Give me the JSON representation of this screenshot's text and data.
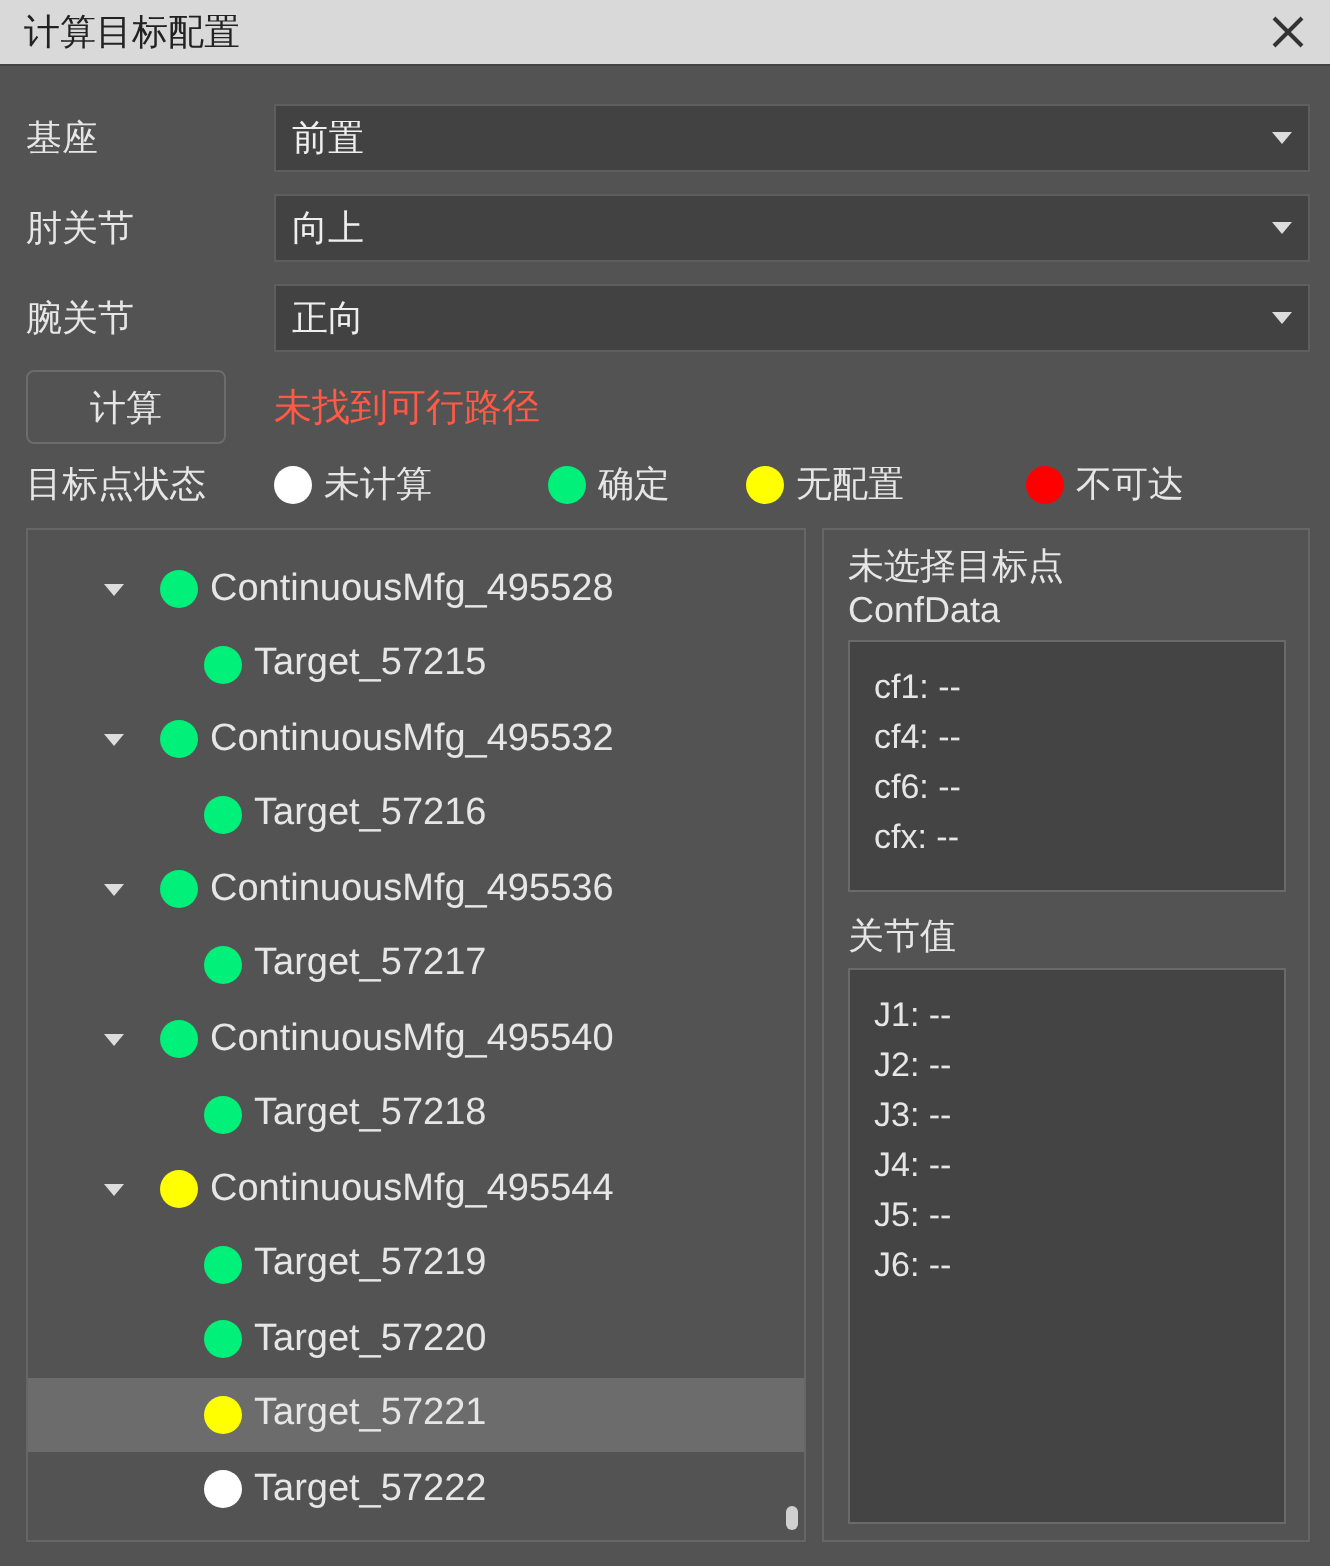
{
  "window": {
    "title": "计算目标配置"
  },
  "settings": [
    {
      "label": "基座",
      "value": "前置"
    },
    {
      "label": "肘关节",
      "value": "向上"
    },
    {
      "label": "腕关节",
      "value": "正向"
    }
  ],
  "calculate_button": "计算",
  "message": "未找到可行路径",
  "legend": {
    "label": "目标点状态",
    "items": [
      {
        "label": "未计算",
        "color": "#ffffff"
      },
      {
        "label": "确定",
        "color": "#00f07a"
      },
      {
        "label": "无配置",
        "color": "#ffff00"
      },
      {
        "label": "不可达",
        "color": "#ff0000"
      }
    ]
  },
  "tree": [
    {
      "label": "ContinuousMfg_495528",
      "color": "#00f07a",
      "expanded": true,
      "selected": false,
      "children": [
        {
          "label": "Target_57215",
          "color": "#00f07a",
          "selected": false
        }
      ]
    },
    {
      "label": "ContinuousMfg_495532",
      "color": "#00f07a",
      "expanded": true,
      "selected": false,
      "children": [
        {
          "label": "Target_57216",
          "color": "#00f07a",
          "selected": false
        }
      ]
    },
    {
      "label": "ContinuousMfg_495536",
      "color": "#00f07a",
      "expanded": true,
      "selected": false,
      "children": [
        {
          "label": "Target_57217",
          "color": "#00f07a",
          "selected": false
        }
      ]
    },
    {
      "label": "ContinuousMfg_495540",
      "color": "#00f07a",
      "expanded": true,
      "selected": false,
      "children": [
        {
          "label": "Target_57218",
          "color": "#00f07a",
          "selected": false
        }
      ]
    },
    {
      "label": "ContinuousMfg_495544",
      "color": "#ffff00",
      "expanded": true,
      "selected": false,
      "children": [
        {
          "label": "Target_57219",
          "color": "#00f07a",
          "selected": false
        },
        {
          "label": "Target_57220",
          "color": "#00f07a",
          "selected": false
        },
        {
          "label": "Target_57221",
          "color": "#ffff00",
          "selected": true
        },
        {
          "label": "Target_57222",
          "color": "#ffffff",
          "selected": false
        }
      ]
    }
  ],
  "details": {
    "target": "未选择目标点",
    "conf_title": "ConfData",
    "conf_lines": [
      "cf1: --",
      "cf4: --",
      "cf6: --",
      "cfx: --"
    ],
    "joint_title": "关节值",
    "joint_lines": [
      "J1: --",
      "J2: --",
      "J3: --",
      "J4: --",
      "J5: --",
      "J6: --"
    ]
  }
}
